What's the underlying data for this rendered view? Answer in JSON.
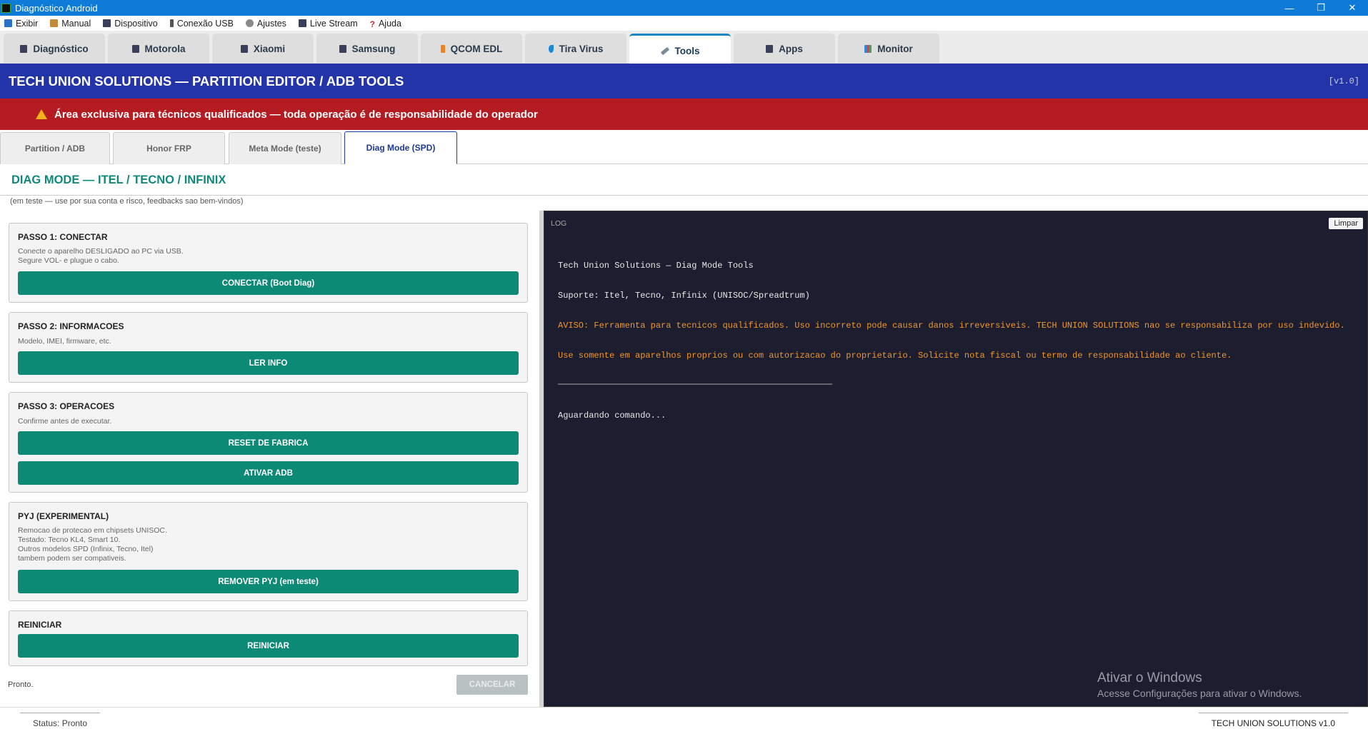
{
  "window": {
    "title": "Diagnóstico Android",
    "minimize": "—",
    "restore": "❐",
    "close": "✕"
  },
  "menu": [
    {
      "label": "Exibir",
      "color": "#2a72c8"
    },
    {
      "label": "Manual",
      "color": "#c48a3a"
    },
    {
      "label": "Dispositivo",
      "color": "#3a3f5a"
    },
    {
      "label": "Conexão USB",
      "color": "#555555"
    },
    {
      "label": "Ajustes",
      "color": "#8a8a8a"
    },
    {
      "label": "Live Stream",
      "color": "#3a3f5a"
    },
    {
      "label": "Ajuda",
      "color": "#d0303a"
    }
  ],
  "tabs": [
    {
      "label": "Diagnóstico",
      "icon": "device-icon"
    },
    {
      "label": "Motorola",
      "icon": "device-icon"
    },
    {
      "label": "Xiaomi",
      "icon": "device-icon"
    },
    {
      "label": "Samsung",
      "icon": "device-icon"
    },
    {
      "label": "QCOM EDL",
      "icon": "lightning-icon"
    },
    {
      "label": "Tira Virus",
      "icon": "drop-icon"
    },
    {
      "label": "Tools",
      "icon": "wrench-icon",
      "active": true
    },
    {
      "label": "Apps",
      "icon": "device-icon"
    },
    {
      "label": "Monitor",
      "icon": "chart-icon"
    }
  ],
  "header": {
    "title": "TECH UNION SOLUTIONS — PARTITION EDITOR / ADB TOOLS",
    "version": "[v1.0]"
  },
  "warning": "Área exclusiva para técnicos qualificados — toda operação é de responsabilidade do operador",
  "subtabs": [
    {
      "label": "Partition / ADB"
    },
    {
      "label": "Honor FRP"
    },
    {
      "label": "Meta Mode (teste)"
    },
    {
      "label": "Diag Mode (SPD)",
      "active": true
    }
  ],
  "page": {
    "title": "DIAG MODE — ITEL / TECNO / INFINIX",
    "note": "(em teste — use por sua conta e risco, feedbacks sao bem-vindos)"
  },
  "cards": {
    "c1": {
      "title": "PASSO 1: CONECTAR",
      "desc1": "Conecte o aparelho DESLIGADO ao PC via USB.",
      "desc2": "Segure VOL- e plugue o cabo.",
      "button": "CONECTAR (Boot Diag)"
    },
    "c2": {
      "title": "PASSO 2: INFORMACOES",
      "desc1": "Modelo, IMEI, firmware, etc.",
      "button": "LER INFO"
    },
    "c3": {
      "title": "PASSO 3: OPERACOES",
      "desc1": "Confirme antes de executar.",
      "button1": "RESET DE FABRICA",
      "button2": "ATIVAR ADB"
    },
    "c4": {
      "title": "PYJ (EXPERIMENTAL)",
      "desc1": "Remocao de protecao em chipsets UNISOC.",
      "desc2": "Testado: Tecno KL4, Smart 10.",
      "desc3": "Outros modelos SPD (Infinix, Tecno, Itel)",
      "desc4": "tambem podem ser compativeis.",
      "button": "REMOVER PYJ (em teste)"
    },
    "c5": {
      "title": "REINICIAR",
      "button": "REINICIAR"
    }
  },
  "footer": {
    "status_text": "Pronto.",
    "cancel": "CANCELAR"
  },
  "log": {
    "label": "LOG",
    "clear": "Limpar",
    "line1": "Tech Union Solutions — Diag Mode Tools",
    "line2": "Suporte: Itel, Tecno, Infinix (UNISOC/Spreadtrum)",
    "line3": "AVISO: Ferramenta para tecnicos qualificados. Uso incorreto pode causar danos irreversiveis. TECH UNION SOLUTIONS nao se responsabiliza por uso indevido.",
    "line4": "Use somente em aparelhos proprios ou com autorizacao do proprietario. Solicite nota fiscal ou termo de responsabilidade ao cliente.",
    "line5": "Aguardando comando..."
  },
  "watermark": {
    "line1": "Ativar o Windows",
    "line2": "Acesse Configurações para ativar o Windows."
  },
  "statusbar": {
    "left": "Status: Pronto",
    "right": "TECH UNION SOLUTIONS v1.0"
  },
  "colors": {
    "accent": "#0d8a76",
    "header": "#2333a8",
    "warning": "#b51c22",
    "log_bg": "#1c1d2e",
    "log_warn": "#f0962a"
  }
}
